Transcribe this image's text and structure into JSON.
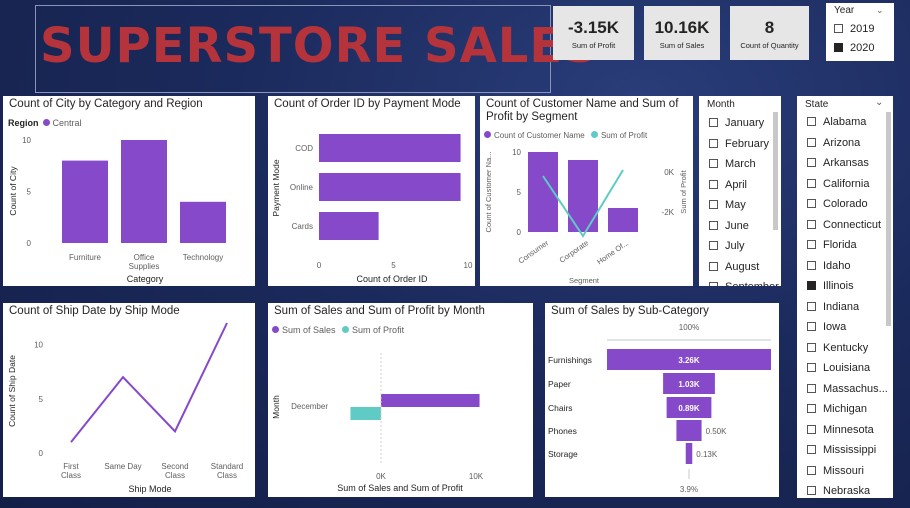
{
  "dashboard": {
    "title": "SUPERSTORE  SALES",
    "colors": {
      "purple": "#8549c9",
      "teal": "#5fcbc4",
      "title_red": "#b5343c",
      "background": "#1b2a5c"
    }
  },
  "kpis": [
    {
      "value": "-3.15K",
      "label": "Sum of Profit"
    },
    {
      "value": "10.16K",
      "label": "Sum of Sales"
    },
    {
      "value": "8",
      "label": "Count of Quantity"
    }
  ],
  "year_slicer": {
    "header": "Year",
    "options": [
      {
        "label": "2019",
        "checked": false
      },
      {
        "label": "2020",
        "checked": true
      }
    ]
  },
  "month_slicer": {
    "header": "Month",
    "options": [
      "January",
      "February",
      "March",
      "April",
      "May",
      "June",
      "July",
      "August",
      "September"
    ]
  },
  "state_slicer": {
    "header": "State",
    "options": [
      {
        "label": "Alabama",
        "checked": false
      },
      {
        "label": "Arizona",
        "checked": false
      },
      {
        "label": "Arkansas",
        "checked": false
      },
      {
        "label": "California",
        "checked": false
      },
      {
        "label": "Colorado",
        "checked": false
      },
      {
        "label": "Connecticut",
        "checked": false
      },
      {
        "label": "Florida",
        "checked": false
      },
      {
        "label": "Idaho",
        "checked": false
      },
      {
        "label": "Illinois",
        "checked": true
      },
      {
        "label": "Indiana",
        "checked": false
      },
      {
        "label": "Iowa",
        "checked": false
      },
      {
        "label": "Kentucky",
        "checked": false
      },
      {
        "label": "Louisiana",
        "checked": false
      },
      {
        "label": "Massachus...",
        "checked": false
      },
      {
        "label": "Michigan",
        "checked": false
      },
      {
        "label": "Minnesota",
        "checked": false
      },
      {
        "label": "Mississippi",
        "checked": false
      },
      {
        "label": "Missouri",
        "checked": false
      },
      {
        "label": "Nebraska",
        "checked": false
      }
    ]
  },
  "chart_data": [
    {
      "id": "city",
      "type": "bar",
      "title": "Count of City by Category and Region",
      "legend_title": "Region",
      "series": [
        {
          "name": "Central",
          "values": [
            8,
            10,
            4
          ]
        }
      ],
      "categories": [
        "Furniture",
        "Office Supplies",
        "Technology"
      ],
      "xlabel": "Category",
      "ylabel": "Count of City",
      "ylim": [
        0,
        10
      ],
      "yticks": [
        "0",
        "5",
        "10"
      ]
    },
    {
      "id": "payment",
      "type": "bar",
      "orientation": "horizontal",
      "title": "Count of Order ID by Payment Mode",
      "categories": [
        "COD",
        "Online",
        "Cards"
      ],
      "values": [
        9.5,
        9.5,
        4
      ],
      "xlabel": "Count of Order ID",
      "ylabel": "Payment Mode",
      "xlim": [
        0,
        10
      ],
      "xticks": [
        "0",
        "5",
        "10"
      ]
    },
    {
      "id": "segment",
      "type": "bar",
      "title": "Count of Customer Name and Sum of Profit by Segment",
      "legend": [
        "Count of Customer Name",
        "Sum of Profit"
      ],
      "categories": [
        "Consumer",
        "Corporate",
        "Home Of..."
      ],
      "series": [
        {
          "name": "Count of Customer Name",
          "values": [
            10,
            9,
            3
          ]
        },
        {
          "name": "Sum of Profit",
          "values": [
            -0.2,
            -3.2,
            0.1
          ]
        }
      ],
      "xlabel": "Segment",
      "ylabel": "Count of Customer Na...",
      "y2label": "Sum of Profit",
      "yticks": [
        "0",
        "5",
        "10"
      ],
      "y2ticks": [
        "0K",
        "-2K"
      ]
    },
    {
      "id": "shipmode",
      "type": "line",
      "title": "Count of Ship Date by Ship Mode",
      "categories": [
        "First Class",
        "Same Day",
        "Second Class",
        "Standard Class"
      ],
      "values": [
        1,
        7,
        2,
        12
      ],
      "xlabel": "Ship Mode",
      "ylabel": "Count of Ship Date",
      "ylim": [
        0,
        12
      ],
      "yticks": [
        "0",
        "5",
        "10"
      ]
    },
    {
      "id": "month",
      "type": "bar",
      "orientation": "horizontal",
      "title": "Sum of Sales and Sum of Profit by Month",
      "legend": [
        "Sum of Sales",
        "Sum of Profit"
      ],
      "categories": [
        "December"
      ],
      "series": [
        {
          "name": "Sum of Sales",
          "values": [
            10160
          ]
        },
        {
          "name": "Sum of Profit",
          "values": [
            -3150
          ]
        }
      ],
      "xlabel": "Sum of Sales and Sum of Profit",
      "ylabel": "Month",
      "xticks": [
        "0K",
        "10K"
      ]
    },
    {
      "id": "subcategory",
      "type": "bar",
      "orientation": "horizontal",
      "subtype": "funnel",
      "title": "Sum of Sales by Sub-Category",
      "categories": [
        "Furnishings",
        "Paper",
        "Chairs",
        "Phones",
        "Storage"
      ],
      "values": [
        3.26,
        1.03,
        0.89,
        0.5,
        0.13
      ],
      "labels": [
        "3.26K",
        "1.03K",
        "0.89K",
        "0.50K",
        "0.13K"
      ],
      "top_label": "100%",
      "bottom_label": "3.9%"
    }
  ]
}
